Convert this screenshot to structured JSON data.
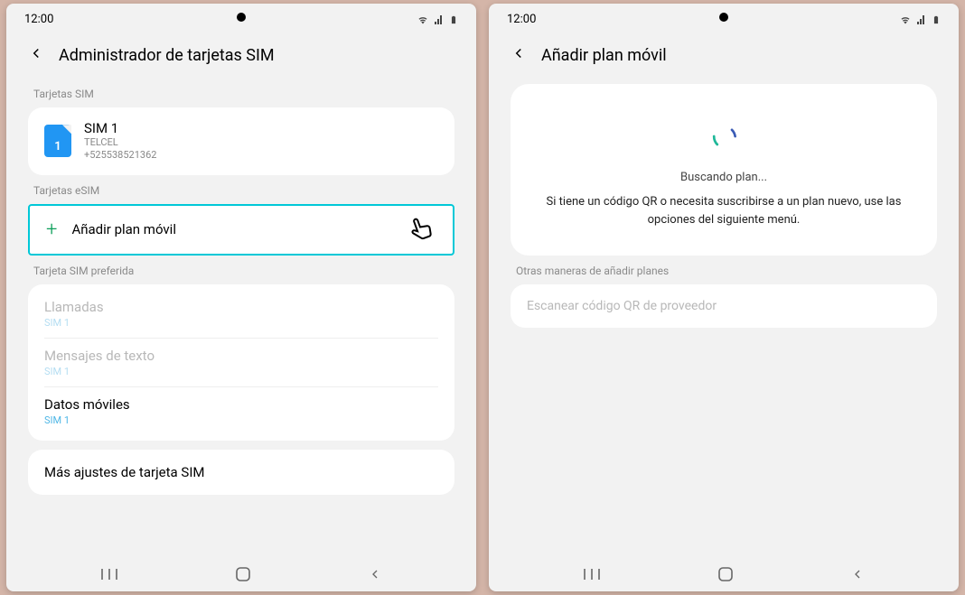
{
  "status": {
    "time": "12:00"
  },
  "left": {
    "header": "Administrador de tarjetas SIM",
    "sections": {
      "sim_label": "Tarjetas SIM",
      "esim_label": "Tarjetas eSIM",
      "preferred_label": "Tarjeta SIM preferida",
      "other_label": "Otras maneras de añadir planes"
    },
    "sim": {
      "badge": "1",
      "title": "SIM 1",
      "carrier": "TELCEL",
      "number": "+525538521362"
    },
    "add_plan": "Añadir plan móvil",
    "preferred": {
      "calls": {
        "label": "Llamadas",
        "value": "SIM 1"
      },
      "messages": {
        "label": "Mensajes de texto",
        "value": "SIM 1"
      },
      "data": {
        "label": "Datos móviles",
        "value": "SIM 1"
      }
    },
    "more": "Más ajustes de tarjeta SIM"
  },
  "right": {
    "header": "Añadir plan móvil",
    "searching": "Buscando plan...",
    "searching_sub": "Si tiene un código QR o necesita suscribirse a un plan nuevo, use las opciones del siguiente menú.",
    "other_label": "Otras maneras de añadir planes",
    "qr_option": "Escanear código QR de proveedor"
  }
}
